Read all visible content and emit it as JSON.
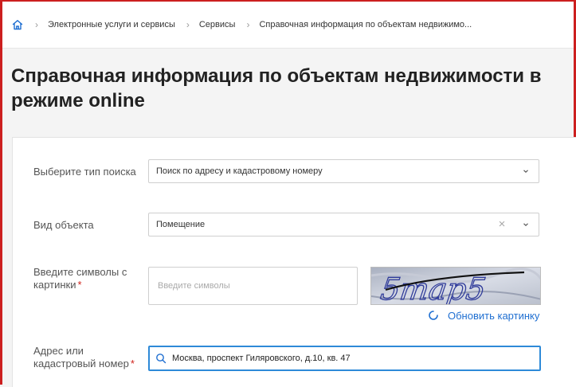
{
  "breadcrumb": {
    "items": [
      {
        "label": "Электронные услуги и сервисы"
      },
      {
        "label": "Сервисы"
      },
      {
        "label": "Справочная информация по объектам недвижимо..."
      }
    ]
  },
  "title": "Справочная информация по объектам недвижимости в режиме online",
  "form": {
    "search_type": {
      "label": "Выберите тип поиска",
      "value": "Поиск по адресу и кадастровому номеру"
    },
    "object_type": {
      "label": "Вид объекта",
      "value": "Помещение"
    },
    "captcha": {
      "label": "Введите символы с картинки",
      "required_mark": "*",
      "placeholder": "Введите символы",
      "image_text": "5map5",
      "refresh_label": "Обновить картинку"
    },
    "address": {
      "label": "Адрес или кадастровый номер",
      "required_mark": "*",
      "value": "Москва, проспект Гиляровского, д.10, кв. 47"
    }
  },
  "colors": {
    "accent": "#1f6fd1",
    "required": "#d0221b",
    "focus_border": "#2e8ad8"
  }
}
